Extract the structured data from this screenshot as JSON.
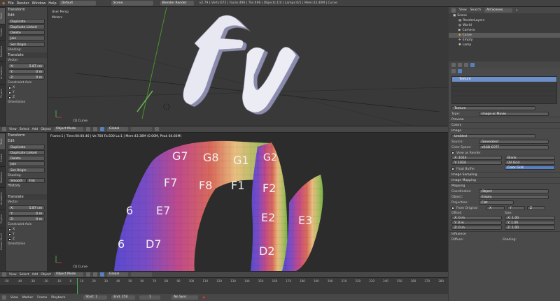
{
  "topbar": {
    "menus": [
      "File",
      "Render",
      "Window",
      "Help"
    ],
    "layout": "Default",
    "scene": "Scene",
    "engine": "Blender Render",
    "stats": "v2.79 | Verts:672 | Faces:496 | Tris:496 | Objects:1/4 | Lamps:0/1 | Mem:43.40M | Curve"
  },
  "shelf_top": {
    "tabs": [
      "Tools",
      "Create",
      "Relations",
      "Animation",
      "Physics",
      "Grease Pencil"
    ],
    "transform_header": "Transform",
    "edit_header": "Edit",
    "buttons": [
      "Duplicate",
      "Duplicate Linked",
      "Delete",
      "Join"
    ],
    "set_origin": "Set Origin",
    "shading_label": "Shading:",
    "shading_buttons": [
      "Smooth",
      "Flat"
    ],
    "history_header": "History",
    "translate_header": "Translate",
    "vector_label": "Vector",
    "vector": [
      {
        "axis": "X:",
        "value": "5.87 cm"
      },
      {
        "axis": "Y:",
        "value": "0 m"
      },
      {
        "axis": "Z:",
        "value": "0 m"
      }
    ],
    "constraint_label": "Constraint Axis",
    "constraint_axes": [
      "X",
      "Y",
      "Z"
    ],
    "orientation_label": "Orientation"
  },
  "viewport_top": {
    "label1": "User Persp",
    "label2": "Meters",
    "object_label": "(1) Curve",
    "header": {
      "menus": [
        "View",
        "Select",
        "Add",
        "Object"
      ],
      "mode": "Object Mode",
      "orientation": "Global"
    }
  },
  "viewport_uv": {
    "info": "Frame:1 | Time:00:00.46 | Mem:49.88M (0.00M, Peak 64.66M)",
    "info_full": "Frame:1 | Time:00:00.46 | Ve:700 Fa:500 La:1 | Mem:43.38M (0.00M, Peak 64.66M)",
    "object_label": "(1) Curve",
    "grid_labels": [
      {
        "t": "G7"
      },
      {
        "t": "G8"
      },
      {
        "t": "G1"
      },
      {
        "t": "G2"
      },
      {
        "t": "F7"
      },
      {
        "t": "F8"
      },
      {
        "t": "F1"
      },
      {
        "t": "F2"
      },
      {
        "t": "E7"
      },
      {
        "t": "E2"
      },
      {
        "t": "E3"
      },
      {
        "t": "D7"
      },
      {
        "t": "D2"
      },
      {
        "t": "6"
      },
      {
        "t": "6"
      }
    ],
    "header": {
      "menus": [
        "View",
        "Select",
        "Add",
        "Object"
      ],
      "mode": "Object Mode",
      "orientation": "Global"
    }
  },
  "timeline": {
    "ticks": [
      "-50",
      "-40",
      "-30",
      "-20",
      "-10",
      "0",
      "10",
      "20",
      "30",
      "40",
      "50",
      "60",
      "70",
      "80",
      "90",
      "100",
      "110",
      "120",
      "130",
      "140",
      "150",
      "160",
      "170",
      "180",
      "190",
      "200",
      "210",
      "220",
      "230",
      "240",
      "250",
      "260",
      "270",
      "280"
    ],
    "menus": [
      "View",
      "Marker",
      "Frame",
      "Playback"
    ],
    "start_label": "Start:",
    "start": "1",
    "end_label": "End:",
    "end": "250",
    "current": "1",
    "sync": "No Sync"
  },
  "outliner": {
    "menus": [
      "View",
      "Search"
    ],
    "filter": "All Scenes",
    "items": [
      {
        "name": "Scene",
        "indent": 0
      },
      {
        "name": "RenderLayers",
        "indent": 1
      },
      {
        "name": "World",
        "indent": 1
      },
      {
        "name": "Camera",
        "indent": 1
      },
      {
        "name": "Curve",
        "indent": 1
      },
      {
        "name": "Empty",
        "indent": 1
      },
      {
        "name": "Lamp",
        "indent": 1
      }
    ]
  },
  "properties": {
    "texture_slot": "Texture",
    "texture_name": "Texture",
    "type_label": "Type:",
    "type_value": "Image or Movie",
    "sections": {
      "preview": "Preview",
      "colors": "Colors",
      "image": "Image",
      "image_sampling": "Image Sampling",
      "image_mapping": "Image Mapping",
      "mapping": "Mapping",
      "influence": "Influence"
    },
    "image_name": "Untitled",
    "source_label": "Source:",
    "source_value": "Generated",
    "colorspace_label": "Color Space:",
    "colorspace_value": "sRGB EOTF",
    "view_as_render": "View as Render",
    "res_x": "X: 1024",
    "res_y": "Y: 1024",
    "float_buffer": "Float Buffer",
    "gen_types": [
      "Blank",
      "UV Grid",
      "Color Grid"
    ],
    "gen_selected": "Color Grid",
    "coordinates_label": "Coordinates:",
    "coordinates_value": "Object",
    "object_label": "Object:",
    "object_value": "Empty",
    "projection_label": "Projection:",
    "projection_value": "Flat",
    "from_original": "From Original",
    "proj_axes": [
      "X",
      "Y",
      "Z"
    ],
    "offset_label": "Offset:",
    "size_label": "Size:",
    "offset": [
      "X: 0 m",
      "Y: 0 m",
      "Z: 0 m"
    ],
    "size": [
      "X: 1.00",
      "Y: 1.00",
      "Z: 1.00"
    ],
    "diffuse_label": "Diffuse:",
    "shading_label": "Shading:"
  },
  "colors": {
    "accent": "#5680c2",
    "selected_row": "#6c8fc8",
    "viewport_bg": "#393939",
    "uv_bg": "#2c2c2c"
  }
}
